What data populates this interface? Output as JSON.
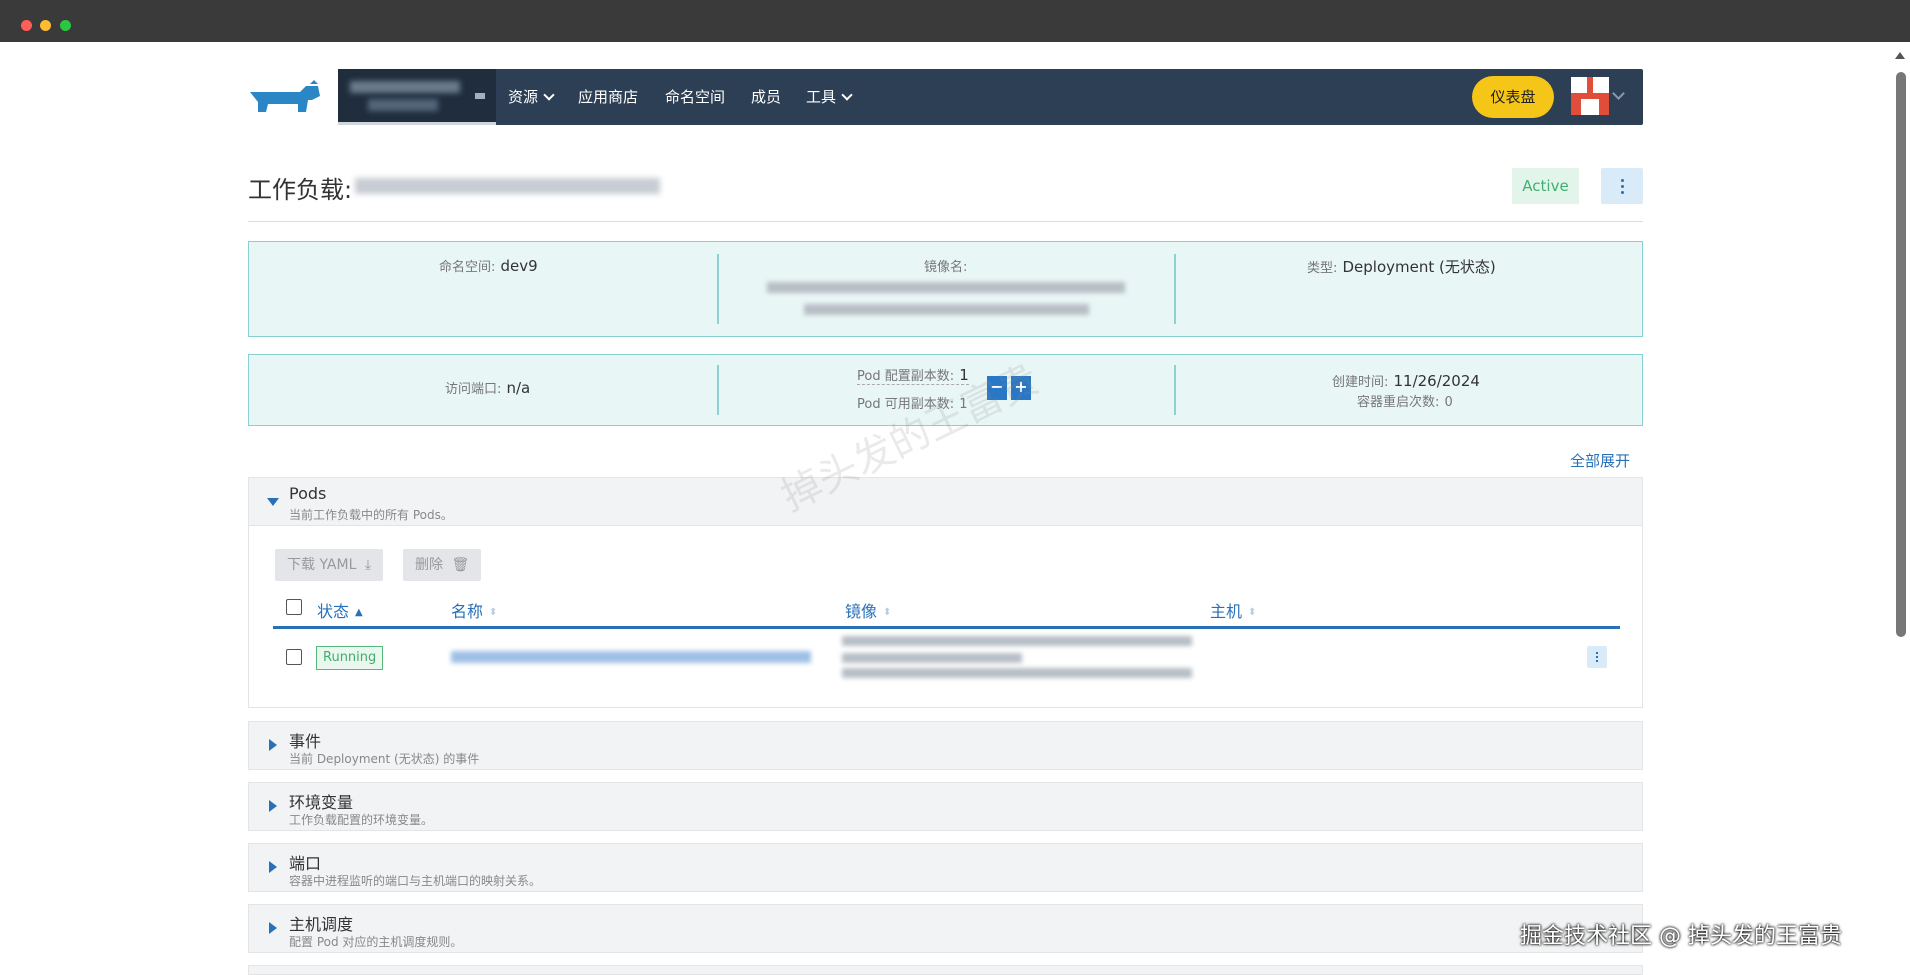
{
  "header": {
    "nav_items": [
      {
        "label": "资源",
        "has_dropdown": true
      },
      {
        "label": "应用商店",
        "has_dropdown": false
      },
      {
        "label": "命名空间",
        "has_dropdown": false
      },
      {
        "label": "成员",
        "has_dropdown": false
      },
      {
        "label": "工具",
        "has_dropdown": true
      }
    ],
    "dashboard_button": "仪表盘"
  },
  "workload": {
    "title_prefix": "工作负载:",
    "status": "Active"
  },
  "info": {
    "namespace_label": "命名空间:",
    "namespace_value": "dev9",
    "image_label": "镜像名:",
    "type_label": "类型:",
    "type_value": "Deployment (无状态)",
    "port_label": "访问端口:",
    "port_value": "n/a",
    "pod_config_label": "Pod 配置副本数:",
    "pod_config_value": "1",
    "pod_available_label": "Pod 可用副本数:",
    "pod_available_value": "1",
    "minus": "−",
    "plus": "+",
    "created_label": "创建时间:",
    "created_value": "11/26/2024",
    "restart_label": "容器重启次数:",
    "restart_value": "0"
  },
  "expand_all": "全部展开",
  "pods": {
    "title": "Pods",
    "subtitle": "当前工作负载中的所有 Pods。",
    "download_yaml": "下载 YAML",
    "delete": "删除",
    "columns": [
      "状态",
      "名称",
      "镜像",
      "主机"
    ],
    "rows": [
      {
        "status": "Running"
      }
    ]
  },
  "sections": [
    {
      "title": "事件",
      "subtitle": "当前 Deployment (无状态) 的事件"
    },
    {
      "title": "环境变量",
      "subtitle": "工作负载配置的环境变量。"
    },
    {
      "title": "端口",
      "subtitle": "容器中进程监听的端口与主机端口的映射关系。"
    },
    {
      "title": "主机调度",
      "subtitle": "配置 Pod 对应的主机调度规则。"
    }
  ],
  "watermark": "掉头发的王富贵",
  "credit": "掘金技术社区 @ 掉头发的王富贵",
  "colors": {
    "nav_bg": "#2c3f54",
    "accent": "#2870b8",
    "dashboard_button": "#f5c518",
    "active_green": "#3fb070",
    "info_box_bg": "#e9f6f6"
  }
}
